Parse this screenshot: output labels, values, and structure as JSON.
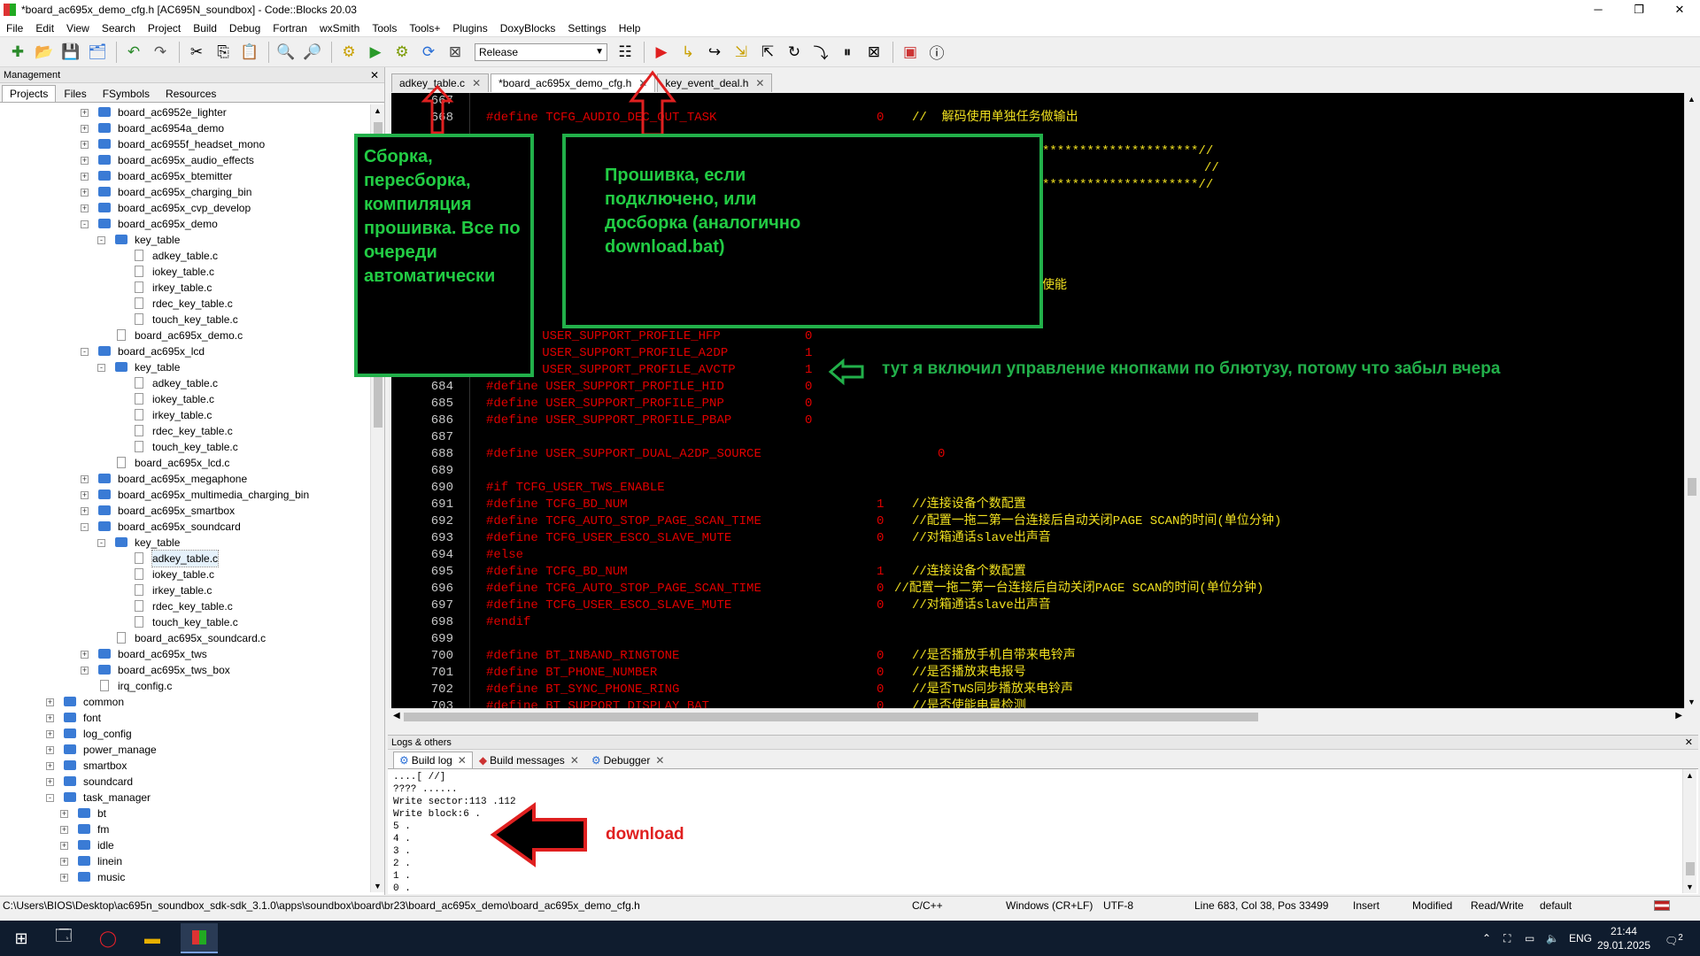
{
  "window": {
    "title": "*board_ac695x_demo_cfg.h [AC695N_soundbox] - Code::Blocks 20.03",
    "minimize": "─",
    "maximize": "❐",
    "close": "✕"
  },
  "menu": [
    "File",
    "Edit",
    "View",
    "Search",
    "Project",
    "Build",
    "Debug",
    "Fortran",
    "wxSmith",
    "Tools",
    "Tools+",
    "Plugins",
    "DoxyBlocks",
    "Settings",
    "Help"
  ],
  "toolbar": {
    "build_target": "Release"
  },
  "management": {
    "title": "Management",
    "close": "✕",
    "tabs": [
      "Projects",
      "Files",
      "FSymbols",
      "Resources"
    ],
    "tree": [
      {
        "label": "board_ac6952e_lighter",
        "level": 1,
        "kind": "folder",
        "exp": "+"
      },
      {
        "label": "board_ac6954a_demo",
        "level": 1,
        "kind": "folder",
        "exp": "+"
      },
      {
        "label": "board_ac6955f_headset_mono",
        "level": 1,
        "kind": "folder",
        "exp": "+"
      },
      {
        "label": "board_ac695x_audio_effects",
        "level": 1,
        "kind": "folder",
        "exp": "+"
      },
      {
        "label": "board_ac695x_btemitter",
        "level": 1,
        "kind": "folder",
        "exp": "+"
      },
      {
        "label": "board_ac695x_charging_bin",
        "level": 1,
        "kind": "folder",
        "exp": "+"
      },
      {
        "label": "board_ac695x_cvp_develop",
        "level": 1,
        "kind": "folder",
        "exp": "+"
      },
      {
        "label": "board_ac695x_demo",
        "level": 1,
        "kind": "folder",
        "exp": "-"
      },
      {
        "label": "key_table",
        "level": 2,
        "kind": "folder",
        "exp": "-"
      },
      {
        "label": "adkey_table.c",
        "level": 3,
        "kind": "file"
      },
      {
        "label": "iokey_table.c",
        "level": 3,
        "kind": "file"
      },
      {
        "label": "irkey_table.c",
        "level": 3,
        "kind": "file"
      },
      {
        "label": "rdec_key_table.c",
        "level": 3,
        "kind": "file"
      },
      {
        "label": "touch_key_table.c",
        "level": 3,
        "kind": "file"
      },
      {
        "label": "board_ac695x_demo.c",
        "level": 2,
        "kind": "file"
      },
      {
        "label": "board_ac695x_lcd",
        "level": 1,
        "kind": "folder",
        "exp": "-"
      },
      {
        "label": "key_table",
        "level": 2,
        "kind": "folder",
        "exp": "-"
      },
      {
        "label": "adkey_table.c",
        "level": 3,
        "kind": "file"
      },
      {
        "label": "iokey_table.c",
        "level": 3,
        "kind": "file"
      },
      {
        "label": "irkey_table.c",
        "level": 3,
        "kind": "file"
      },
      {
        "label": "rdec_key_table.c",
        "level": 3,
        "kind": "file"
      },
      {
        "label": "touch_key_table.c",
        "level": 3,
        "kind": "file"
      },
      {
        "label": "board_ac695x_lcd.c",
        "level": 2,
        "kind": "file"
      },
      {
        "label": "board_ac695x_megaphone",
        "level": 1,
        "kind": "folder",
        "exp": "+"
      },
      {
        "label": "board_ac695x_multimedia_charging_bin",
        "level": 1,
        "kind": "folder",
        "exp": "+"
      },
      {
        "label": "board_ac695x_smartbox",
        "level": 1,
        "kind": "folder",
        "exp": "+"
      },
      {
        "label": "board_ac695x_soundcard",
        "level": 1,
        "kind": "folder",
        "exp": "-"
      },
      {
        "label": "key_table",
        "level": 2,
        "kind": "folder",
        "exp": "-"
      },
      {
        "label": "adkey_table.c",
        "level": 3,
        "kind": "file",
        "selected": true
      },
      {
        "label": "iokey_table.c",
        "level": 3,
        "kind": "file"
      },
      {
        "label": "irkey_table.c",
        "level": 3,
        "kind": "file"
      },
      {
        "label": "rdec_key_table.c",
        "level": 3,
        "kind": "file"
      },
      {
        "label": "touch_key_table.c",
        "level": 3,
        "kind": "file"
      },
      {
        "label": "board_ac695x_soundcard.c",
        "level": 2,
        "kind": "file"
      },
      {
        "label": "board_ac695x_tws",
        "level": 1,
        "kind": "folder",
        "exp": "+"
      },
      {
        "label": "board_ac695x_tws_box",
        "level": 1,
        "kind": "folder",
        "exp": "+"
      },
      {
        "label": "irq_config.c",
        "level": 1,
        "kind": "file"
      },
      {
        "label": "common",
        "level": -1,
        "kind": "folder",
        "exp": "+"
      },
      {
        "label": "font",
        "level": -1,
        "kind": "folder",
        "exp": "+"
      },
      {
        "label": "log_config",
        "level": -1,
        "kind": "folder",
        "exp": "+"
      },
      {
        "label": "power_manage",
        "level": -1,
        "kind": "folder",
        "exp": "+"
      },
      {
        "label": "smartbox",
        "level": -1,
        "kind": "folder",
        "exp": "+"
      },
      {
        "label": "soundcard",
        "level": -1,
        "kind": "folder",
        "exp": "+"
      },
      {
        "label": "task_manager",
        "level": -1,
        "kind": "folder",
        "exp": "-"
      },
      {
        "label": "bt",
        "level": 0,
        "kind": "folder",
        "exp": "+"
      },
      {
        "label": "fm",
        "level": 0,
        "kind": "folder",
        "exp": "+"
      },
      {
        "label": "idle",
        "level": 0,
        "kind": "folder",
        "exp": "+"
      },
      {
        "label": "linein",
        "level": 0,
        "kind": "folder",
        "exp": "+"
      },
      {
        "label": "music",
        "level": 0,
        "kind": "folder",
        "exp": "+"
      }
    ]
  },
  "editor": {
    "tabs": [
      "adkey_table.c",
      "*board_ac695x_demo_cfg.h",
      "key_event_deal.h"
    ],
    "lines": [
      {
        "n": "667",
        "def": "",
        "val": "",
        "cmt": ""
      },
      {
        "n": "668",
        "def": "#define TCFG_AUDIO_DEC_OUT_TASK",
        "val": "0",
        "cmt": "//  解码使用单独任务做输出"
      },
      {
        "n": "",
        "def": "",
        "val": "",
        "cmt": ""
      },
      {
        "n": "",
        "def": "",
        "val": "",
        "cmt": "*********************//"
      },
      {
        "n": "",
        "def": "",
        "val": "",
        "cmt": "//"
      },
      {
        "n": "",
        "def": "",
        "val": "",
        "cmt": "*********************//"
      },
      {
        "n": "",
        "def": "",
        "val": "",
        "cmt": ""
      },
      {
        "n": "",
        "def": "",
        "val": "",
        "cmt": ""
      },
      {
        "n": "",
        "def": "",
        "val": "",
        "cmt": ""
      },
      {
        "n": "",
        "def": "",
        "val": "",
        "cmt": ""
      },
      {
        "n": "",
        "def": "",
        "val": "",
        "cmt": ""
      },
      {
        "n": "",
        "def": "",
        "val": "",
        "cmt": "使能"
      },
      {
        "n": "",
        "def": "",
        "val": "",
        "cmt": ""
      },
      {
        "n": "",
        "def": "",
        "val": "",
        "cmt": ""
      },
      {
        "n": "",
        "def": "ne USER_SUPPORT_PROFILE_HFP",
        "val": "0",
        "cmt": ""
      },
      {
        "n": "",
        "def": "ne USER_SUPPORT_PROFILE_A2DP",
        "val": "1",
        "cmt": ""
      },
      {
        "n": "",
        "def": "ne USER_SUPPORT_PROFILE_AVCTP",
        "val": "1",
        "cmt": ""
      },
      {
        "n": "684",
        "def": "#define USER_SUPPORT_PROFILE_HID",
        "val": "0",
        "cmt": ""
      },
      {
        "n": "685",
        "def": "#define USER_SUPPORT_PROFILE_PNP",
        "val": "0",
        "cmt": ""
      },
      {
        "n": "686",
        "def": "#define USER_SUPPORT_PROFILE_PBAP",
        "val": "0",
        "cmt": ""
      },
      {
        "n": "687",
        "def": "",
        "val": "",
        "cmt": ""
      },
      {
        "n": "688",
        "def": "#define USER_SUPPORT_DUAL_A2DP_SOURCE",
        "val": "0",
        "cmt": ""
      },
      {
        "n": "689",
        "def": "",
        "val": "",
        "cmt": ""
      },
      {
        "n": "690",
        "def": "#if TCFG_USER_TWS_ENABLE",
        "val": "",
        "cmt": ""
      },
      {
        "n": "691",
        "def": "#define TCFG_BD_NUM",
        "val": "1",
        "cmt": "//连接设备个数配置"
      },
      {
        "n": "692",
        "def": "#define TCFG_AUTO_STOP_PAGE_SCAN_TIME",
        "val": "0",
        "cmt": "//配置一拖二第一台连接后自动关闭PAGE SCAN的时间(单位分钟)"
      },
      {
        "n": "693",
        "def": "#define TCFG_USER_ESCO_SLAVE_MUTE",
        "val": "0",
        "cmt": "//对箱通话slave出声音"
      },
      {
        "n": "694",
        "def": "#else",
        "val": "",
        "cmt": ""
      },
      {
        "n": "695",
        "def": "#define TCFG_BD_NUM",
        "val": "1",
        "cmt": "//连接设备个数配置"
      },
      {
        "n": "696",
        "def": "#define TCFG_AUTO_STOP_PAGE_SCAN_TIME",
        "val": "0",
        "cmt": "//配置一拖二第一台连接后自动关闭PAGE SCAN的时间(单位分钟)"
      },
      {
        "n": "697",
        "def": "#define TCFG_USER_ESCO_SLAVE_MUTE",
        "val": "0",
        "cmt": "//对箱通话slave出声音"
      },
      {
        "n": "698",
        "def": "#endif",
        "val": "",
        "cmt": ""
      },
      {
        "n": "699",
        "def": "",
        "val": "",
        "cmt": ""
      },
      {
        "n": "700",
        "def": "#define BT_INBAND_RINGTONE",
        "val": "0",
        "cmt": "//是否播放手机自带来电铃声"
      },
      {
        "n": "701",
        "def": "#define BT_PHONE_NUMBER",
        "val": "0",
        "cmt": "//是否播放来电报号"
      },
      {
        "n": "702",
        "def": "#define BT_SYNC_PHONE_RING",
        "val": "0",
        "cmt": "//是否TWS同步播放来电铃声"
      },
      {
        "n": "703",
        "def": "#define BT_SUPPORT_DISPLAY_BAT",
        "val": "0",
        "cmt": "//是否使能电量检测"
      }
    ]
  },
  "annotations": {
    "build_box": "Сборка, пересборка, компиляция прошивка. Все по очереди автоматически",
    "flash_box": "Прошивка, если подключено, или досборка (аналогично download.bat)",
    "bt_note": "тут я включил управление кнопками по блютузу, потому что забыл вчера",
    "download_note": "download"
  },
  "logs": {
    "title": "Logs & others",
    "close": "✕",
    "tabs": [
      "Build log",
      "Build messages",
      "Debugger"
    ],
    "lines": [
      "....[ //]",
      "???? ......",
      "Write sector:113 .112",
      "Write block:6 .",
      "5 .",
      "4 .",
      "3 .",
      "2 .",
      "1 .",
      "0 ."
    ]
  },
  "status": {
    "path": "C:\\Users\\BIOS\\Desktop\\ac695n_soundbox_sdk-sdk_3.1.0\\apps\\soundbox\\board\\br23\\board_ac695x_demo\\board_ac695x_demo_cfg.h",
    "lang": "C/C++",
    "eol": "Windows (CR+LF)",
    "encoding": "UTF-8",
    "position": "Line 683, Col 38, Pos 33499",
    "mode": "Insert",
    "modified": "Modified",
    "rw": "Read/Write",
    "profile": "default"
  },
  "taskbar": {
    "lang": "ENG",
    "time": "21:44",
    "date": "29.01.2025",
    "notif": "2"
  },
  "colors": {
    "annotation_green": "#22b04a",
    "arrow_red": "#e02020",
    "code_define": "#e00000",
    "code_comment": "#f0e020"
  }
}
